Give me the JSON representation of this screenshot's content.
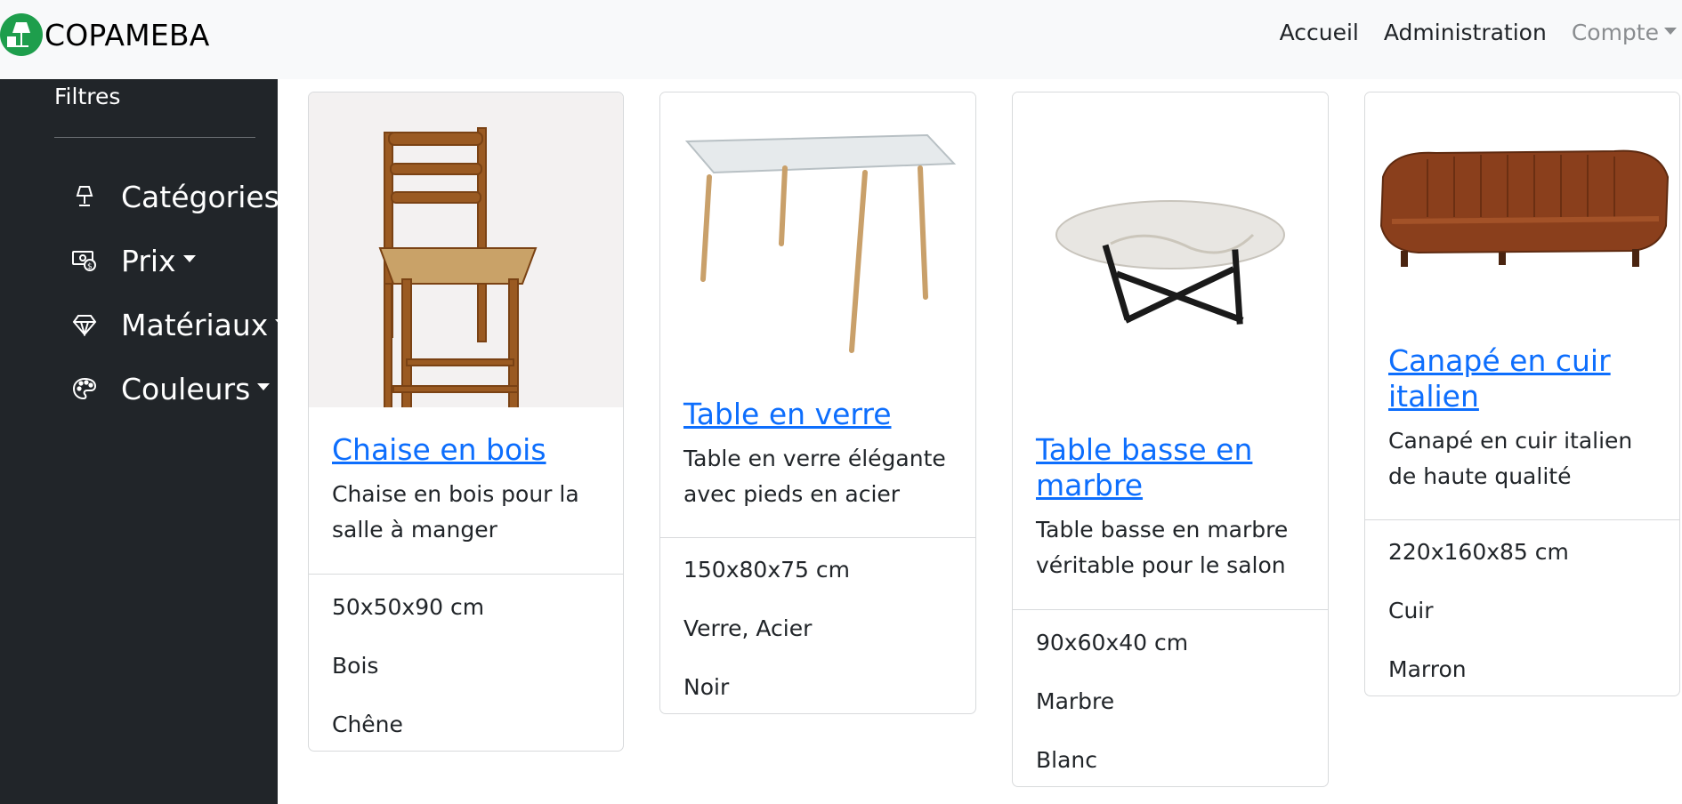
{
  "brand": {
    "name": "COPAMEBA"
  },
  "nav": {
    "home": "Accueil",
    "admin": "Administration",
    "account": "Compte"
  },
  "sidebar": {
    "title": "Filtres",
    "filters": [
      {
        "label": "Catégories",
        "icon": "lamp-icon"
      },
      {
        "label": "Prix",
        "icon": "money-icon"
      },
      {
        "label": "Matériaux",
        "icon": "diamond-icon"
      },
      {
        "label": "Couleurs",
        "icon": "palette-icon"
      }
    ]
  },
  "products": [
    {
      "title": "Chaise en bois",
      "description": "Chaise en bois pour la salle à manger",
      "dimensions": "50x50x90 cm",
      "material": "Bois",
      "color": "Chêne",
      "image": "wooden-chair-image"
    },
    {
      "title": "Table en verre",
      "description": "Table en verre élégante avec pieds en acier",
      "dimensions": "150x80x75 cm",
      "material": "Verre, Acier",
      "color": "Noir",
      "image": "glass-table-image"
    },
    {
      "title": "Table basse en marbre",
      "description": "Table basse en marbre véritable pour le salon",
      "dimensions": "90x60x40 cm",
      "material": "Marbre",
      "color": "Blanc",
      "image": "marble-coffee-table-image"
    },
    {
      "title": "Canapé en cuir italien",
      "description": "Canapé en cuir italien de haute qualité",
      "dimensions": "220x160x85 cm",
      "material": "Cuir",
      "color": "Marron",
      "image": "leather-sofa-image"
    }
  ],
  "colors": {
    "navbar_bg": "#f8f9fa",
    "sidebar_bg": "#212529",
    "link": "#0d6efd",
    "brand_green": "#1e9e4c"
  }
}
